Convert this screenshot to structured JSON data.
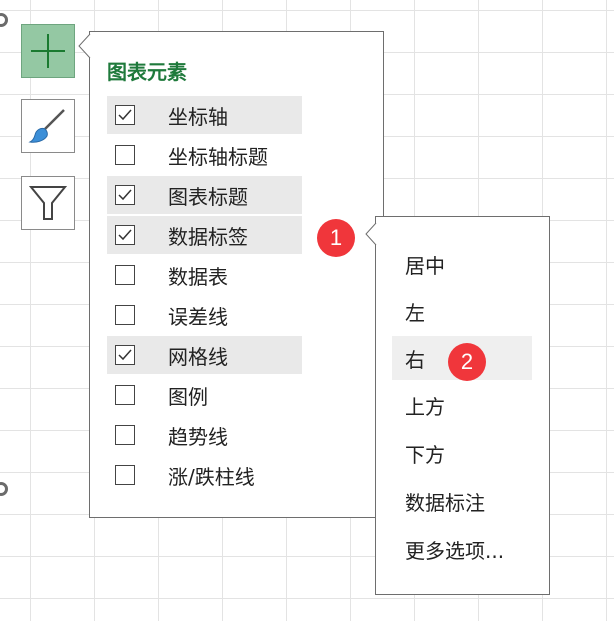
{
  "chart_elements_panel": {
    "title": "图表元素",
    "items": [
      {
        "label": "坐标轴",
        "checked": true
      },
      {
        "label": "坐标轴标题",
        "checked": false
      },
      {
        "label": "图表标题",
        "checked": true
      },
      {
        "label": "数据标签",
        "checked": true
      },
      {
        "label": "数据表",
        "checked": false
      },
      {
        "label": "误差线",
        "checked": false
      },
      {
        "label": "网格线",
        "checked": true
      },
      {
        "label": "图例",
        "checked": false
      },
      {
        "label": "趋势线",
        "checked": false
      },
      {
        "label": "涨/跌柱线",
        "checked": false
      }
    ]
  },
  "data_labels_submenu": {
    "items": [
      "居中",
      "左",
      "右",
      "上方",
      "下方",
      "数据标注",
      "更多选项..."
    ]
  },
  "badges": {
    "first": "1",
    "second": "2"
  },
  "side_buttons": [
    "plus-icon",
    "brush-icon",
    "filter-icon"
  ],
  "colors": {
    "accent_green": "#94c8a3",
    "title_green": "#1f7a3c",
    "badge_red": "#f0363b"
  }
}
